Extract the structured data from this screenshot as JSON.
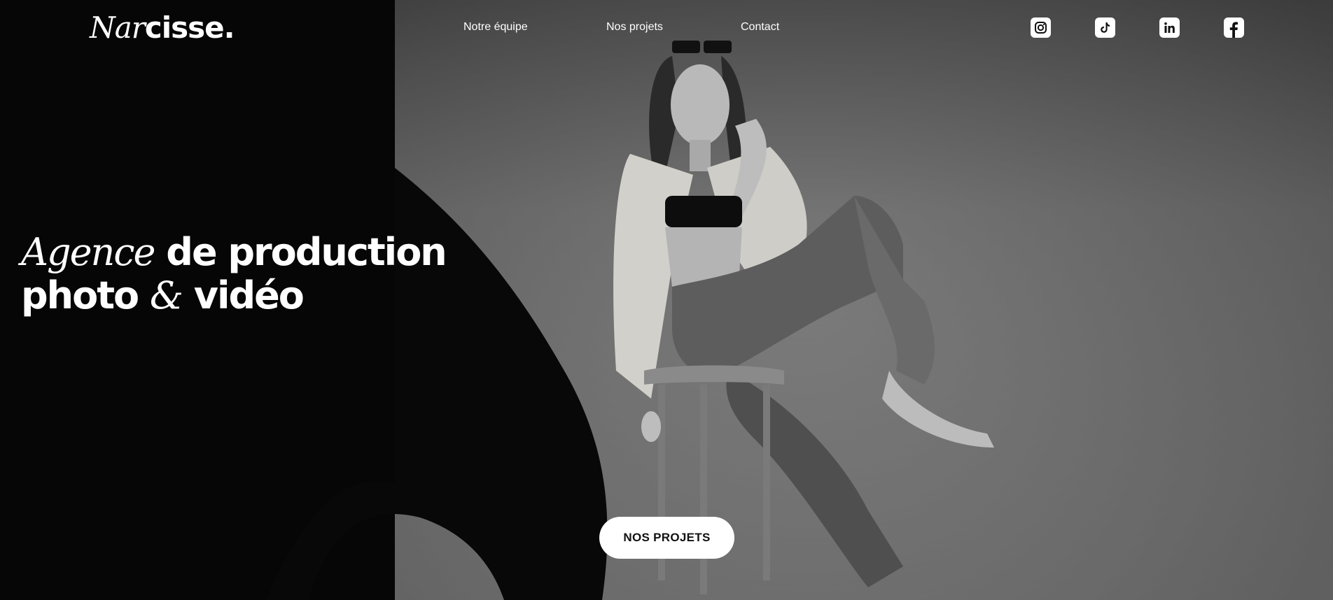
{
  "brand": {
    "logo_italic": "Nar",
    "logo_bold": "cisse."
  },
  "nav": {
    "items": [
      {
        "label": "Notre équipe"
      },
      {
        "label": "Nos projets"
      },
      {
        "label": "Contact"
      }
    ]
  },
  "social": {
    "icons": [
      "instagram-icon",
      "tiktok-icon",
      "linkedin-icon",
      "facebook-icon"
    ]
  },
  "hero": {
    "headline_italic_1": "Agence",
    "headline_bold_1": " de production",
    "headline_bold_2": "photo ",
    "headline_italic_2": "&",
    "headline_bold_3": " vidéo",
    "cta_label": "NOS PROJETS"
  },
  "colors": {
    "text": "#ffffff",
    "button_bg": "#ffffff",
    "button_text": "#111111",
    "background_dark": "#050505"
  }
}
